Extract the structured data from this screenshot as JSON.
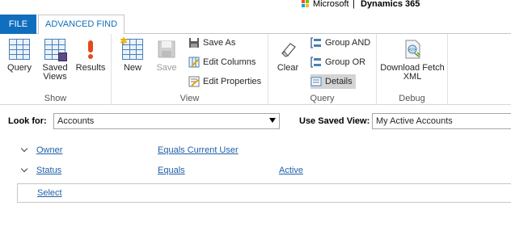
{
  "brand": {
    "company": "Microsoft",
    "separator": "|",
    "product": "Dynamics 365",
    "logo_colors": [
      "#f25022",
      "#7fba00",
      "#00a4ef",
      "#ffb900"
    ]
  },
  "tabs": {
    "file": "FILE",
    "advanced_find": "ADVANCED FIND"
  },
  "ribbon": {
    "show": {
      "label": "Show",
      "query": "Query",
      "saved_views": "Saved Views",
      "results": "Results"
    },
    "view": {
      "label": "View",
      "new": "New",
      "save": "Save",
      "save_as": "Save As",
      "edit_columns": "Edit Columns",
      "edit_properties": "Edit Properties"
    },
    "query": {
      "label": "Query",
      "clear": "Clear",
      "group_and": "Group AND",
      "group_or": "Group OR",
      "details": "Details"
    },
    "debug": {
      "label": "Debug",
      "download_fetch_xml": "Download Fetch XML"
    }
  },
  "lookfor": {
    "label": "Look for:",
    "value": "Accounts",
    "saved_view_label": "Use Saved View:",
    "saved_view_value": "My Active Accounts"
  },
  "conditions": [
    {
      "field": "Owner",
      "operator": "Equals Current User",
      "value": ""
    },
    {
      "field": "Status",
      "operator": "Equals",
      "value": "Active"
    }
  ],
  "select_link": "Select",
  "colors": {
    "accent": "#106ebe",
    "link": "#1f5fa8"
  }
}
